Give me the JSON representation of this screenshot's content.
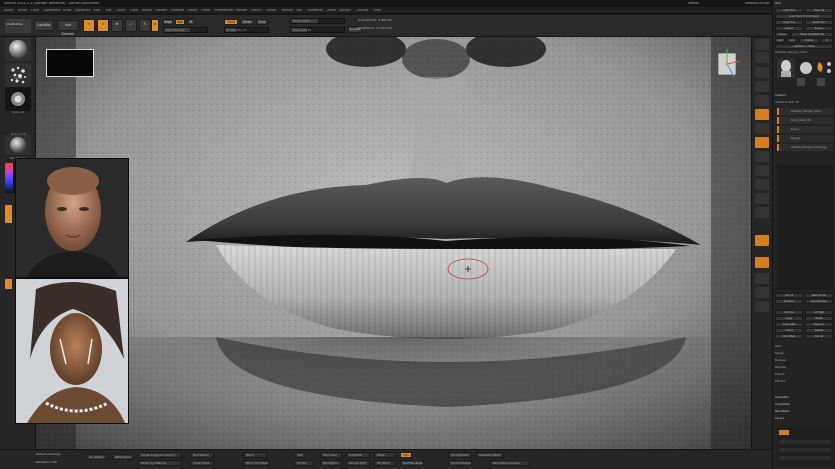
{
  "window": {
    "title": "ZBrush 2021.1.2 (license: weekend) - ZBrush Document",
    "title_right_a": "Menus",
    "title_right_b": "DefaultZScript"
  },
  "menu": [
    "Alpha",
    "Brush",
    "Color",
    "Document",
    "Draw",
    "Dynamics",
    "Edit",
    "File",
    "Layer",
    "Light",
    "Macro",
    "Marker",
    "Material",
    "Movie",
    "Picker",
    "Preferences",
    "Render",
    "Stencil",
    "Stroke",
    "Texture",
    "Tool",
    "Transform",
    "Zoom",
    "Zplugin",
    "Zscript",
    "Help"
  ],
  "topshelf": {
    "lightbox": "LightBox",
    "live_boolean": "Live Boolean",
    "edit": "Edit",
    "draw": "Draw",
    "move": "Move",
    "scale": "Scale",
    "rotate": "Rotate",
    "mrgb": "Mrgb",
    "rgb": "Rgb",
    "m": "M",
    "zadd": "Zadd",
    "zsub": "Zsub",
    "zcut": "Zcut",
    "rgb_intensity": "Rgb Intensity",
    "z_intensity": "Z Intensity 25",
    "draw_size": "Draw Size 64",
    "focal_shift": "Focal Shift 0",
    "active_points": "ActivePoints: 3,486 Mil",
    "total_points": "TotalPoints: 12.872 Mil",
    "dynamic": "Dynamic",
    "rgb_intensity_level": 0.6,
    "z_intensity_level": 0.25,
    "draw_size_level": 0.3,
    "focal_shift_level": 0.5
  },
  "leftshelf": {
    "brush_label": "ClayBuildup",
    "stroke_label": "Spray",
    "alpha_label": "Alpha 22",
    "texture_label": "Texture Off",
    "material_label": "SkinShade4"
  },
  "tray": {
    "header": "Tool",
    "load_tool": "Load Tool",
    "save_as": "Save As",
    "load_tools_from_project": "Load Tools From Project",
    "copy_tool": "Copy Tool",
    "paste_tool": "Paste Tool",
    "import": "Import",
    "export": "Export",
    "clone": "Clone",
    "make_polymesh": "Make PolyMesh3D",
    "goz": "GoZ",
    "all": "All",
    "visible": "Visible",
    "r": "R",
    "lightbox_tools": "Lightbox > Tools",
    "current_tool": "Wrestler_Merged_Sub3",
    "subtool_header": "Subtool",
    "visible_count": "Visible Count: 11",
    "subtools": [
      "Wrestler_Merged_Sub3",
      "Body_Detail_01",
      "Eyes_L",
      "Eyes_R",
      "Wrestler_Merged_Sub3_eye"
    ],
    "list_all": "List All",
    "new_folder": "New Folder",
    "rename": "Rename",
    "auto_reorder": "AutoReorder",
    "all_low": "All Low",
    "all_high": "All High",
    "copy": "Copy",
    "paste": "Paste",
    "duplicate": "Duplicate",
    "append": "Append",
    "insert": "Insert",
    "delete": "Delete",
    "del_other": "Del Other",
    "del_all": "Del All",
    "split": "Split",
    "merge": "Merge",
    "boolean": "Boolean",
    "remesh": "Remesh",
    "project": "Project",
    "extract": "Extract",
    "geometry": "Geometry",
    "arraymesh": "ArrayMesh",
    "nanomesh": "NanoMesh",
    "layers": "Layers"
  },
  "bottomshelf": {
    "subtool_label": "Default Ze/merge",
    "dynamesh_res": "Resolution 128",
    "dynamesh": "DynaMesh",
    "zremesher": "ZRemesher",
    "target_polygons": "Target Polygons Count 5",
    "del_hidden": "Del Hidden",
    "close_holes": "Close Holes",
    "mirror": "Mirror",
    "mirror_and_weld": "Mirror And Weld",
    "smt": "Smt",
    "del_lower": "Del Lower",
    "del_higher": "Del Higher",
    "project_all": "ProjectAll",
    "groups_split": "Groups Split",
    "polish": "Polish",
    "group_visible": "GroupVisible",
    "group_masked": "Group Masked",
    "resolution_mesh": "ResolutionMesh",
    "polypaint": "PolyPaint",
    "sdiv": "SDiv 6",
    "reconstruct": "Reconstruct Subdiv",
    "divide": "Divide",
    "backface_mask": "BackfaceMask",
    "polish_by_features": "Polish by Features"
  },
  "colors": {
    "accent": "#e08a2a",
    "panel": "#262626",
    "background": "#1b1b1b"
  }
}
